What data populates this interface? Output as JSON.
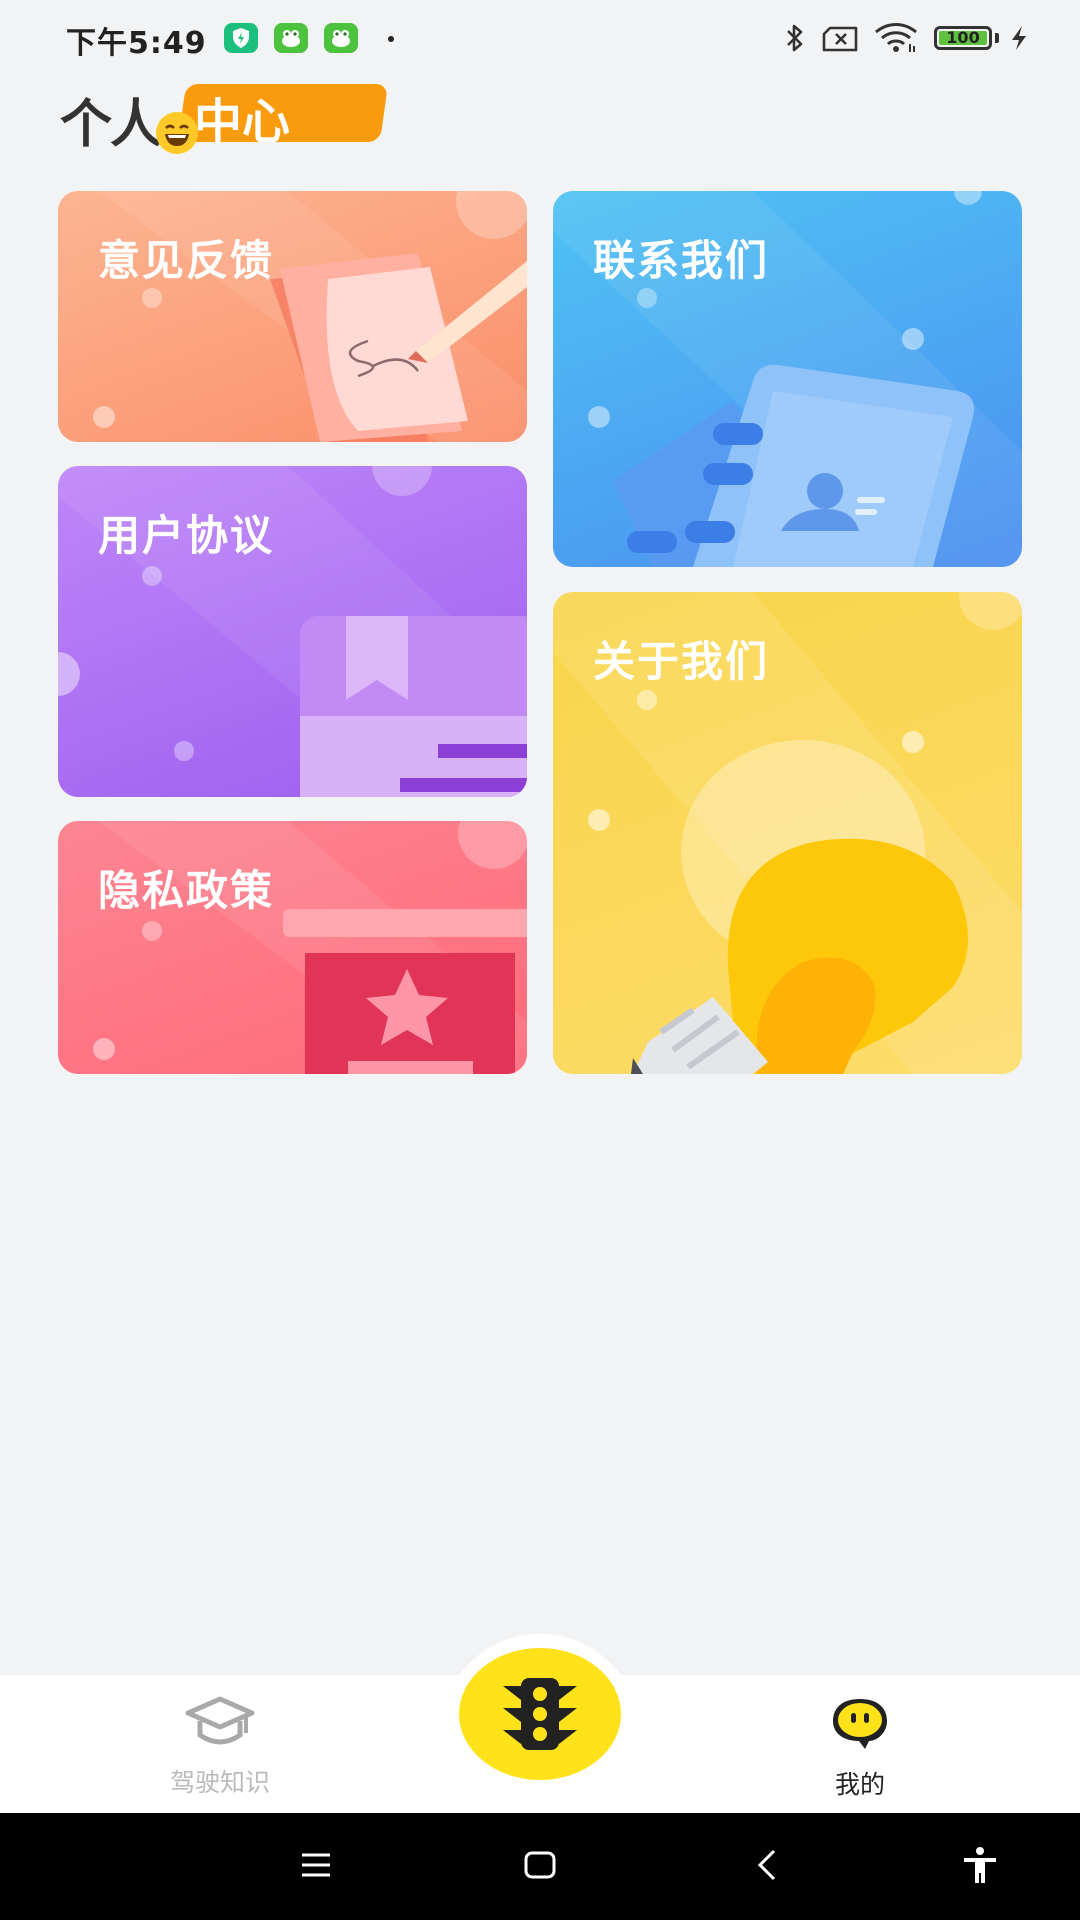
{
  "status_bar": {
    "time": "下午5:49",
    "battery_text": "100",
    "battery_level": 1.0,
    "icons": [
      "shield-app-icon",
      "frog-app-icon",
      "frog-app-icon",
      "notification-dot",
      "bluetooth-icon",
      "no-sim-icon",
      "wifi-icon",
      "battery-icon",
      "charging-icon"
    ]
  },
  "header": {
    "title_part1": "个人",
    "title_part2": "中心"
  },
  "cards": {
    "feedback": {
      "label": "意见反馈",
      "icon": "note-pen-icon"
    },
    "contact": {
      "label": "联系我们",
      "icon": "contact-book-icon"
    },
    "agreement": {
      "label": "用户协议",
      "icon": "bookmark-document-icon"
    },
    "about": {
      "label": "关于我们",
      "icon": "lightbulb-icon"
    },
    "privacy": {
      "label": "隐私政策",
      "icon": "star-box-icon"
    }
  },
  "bottom_nav": {
    "knowledge_label": "驾驶知识",
    "center_icon": "traffic-light-icon",
    "mine_label": "我的",
    "active_color": "#222222",
    "inactive_color": "#bbbbbb"
  },
  "system_nav": {
    "icons": [
      "menu-icon",
      "home-icon",
      "back-icon",
      "accessibility-icon"
    ]
  },
  "colors": {
    "feedback": "#fb9a72",
    "contact": "#4aa6f0",
    "agreement": "#b07af0",
    "about": "#fad24a",
    "privacy": "#fd7585",
    "accent": "#ffe21a"
  }
}
